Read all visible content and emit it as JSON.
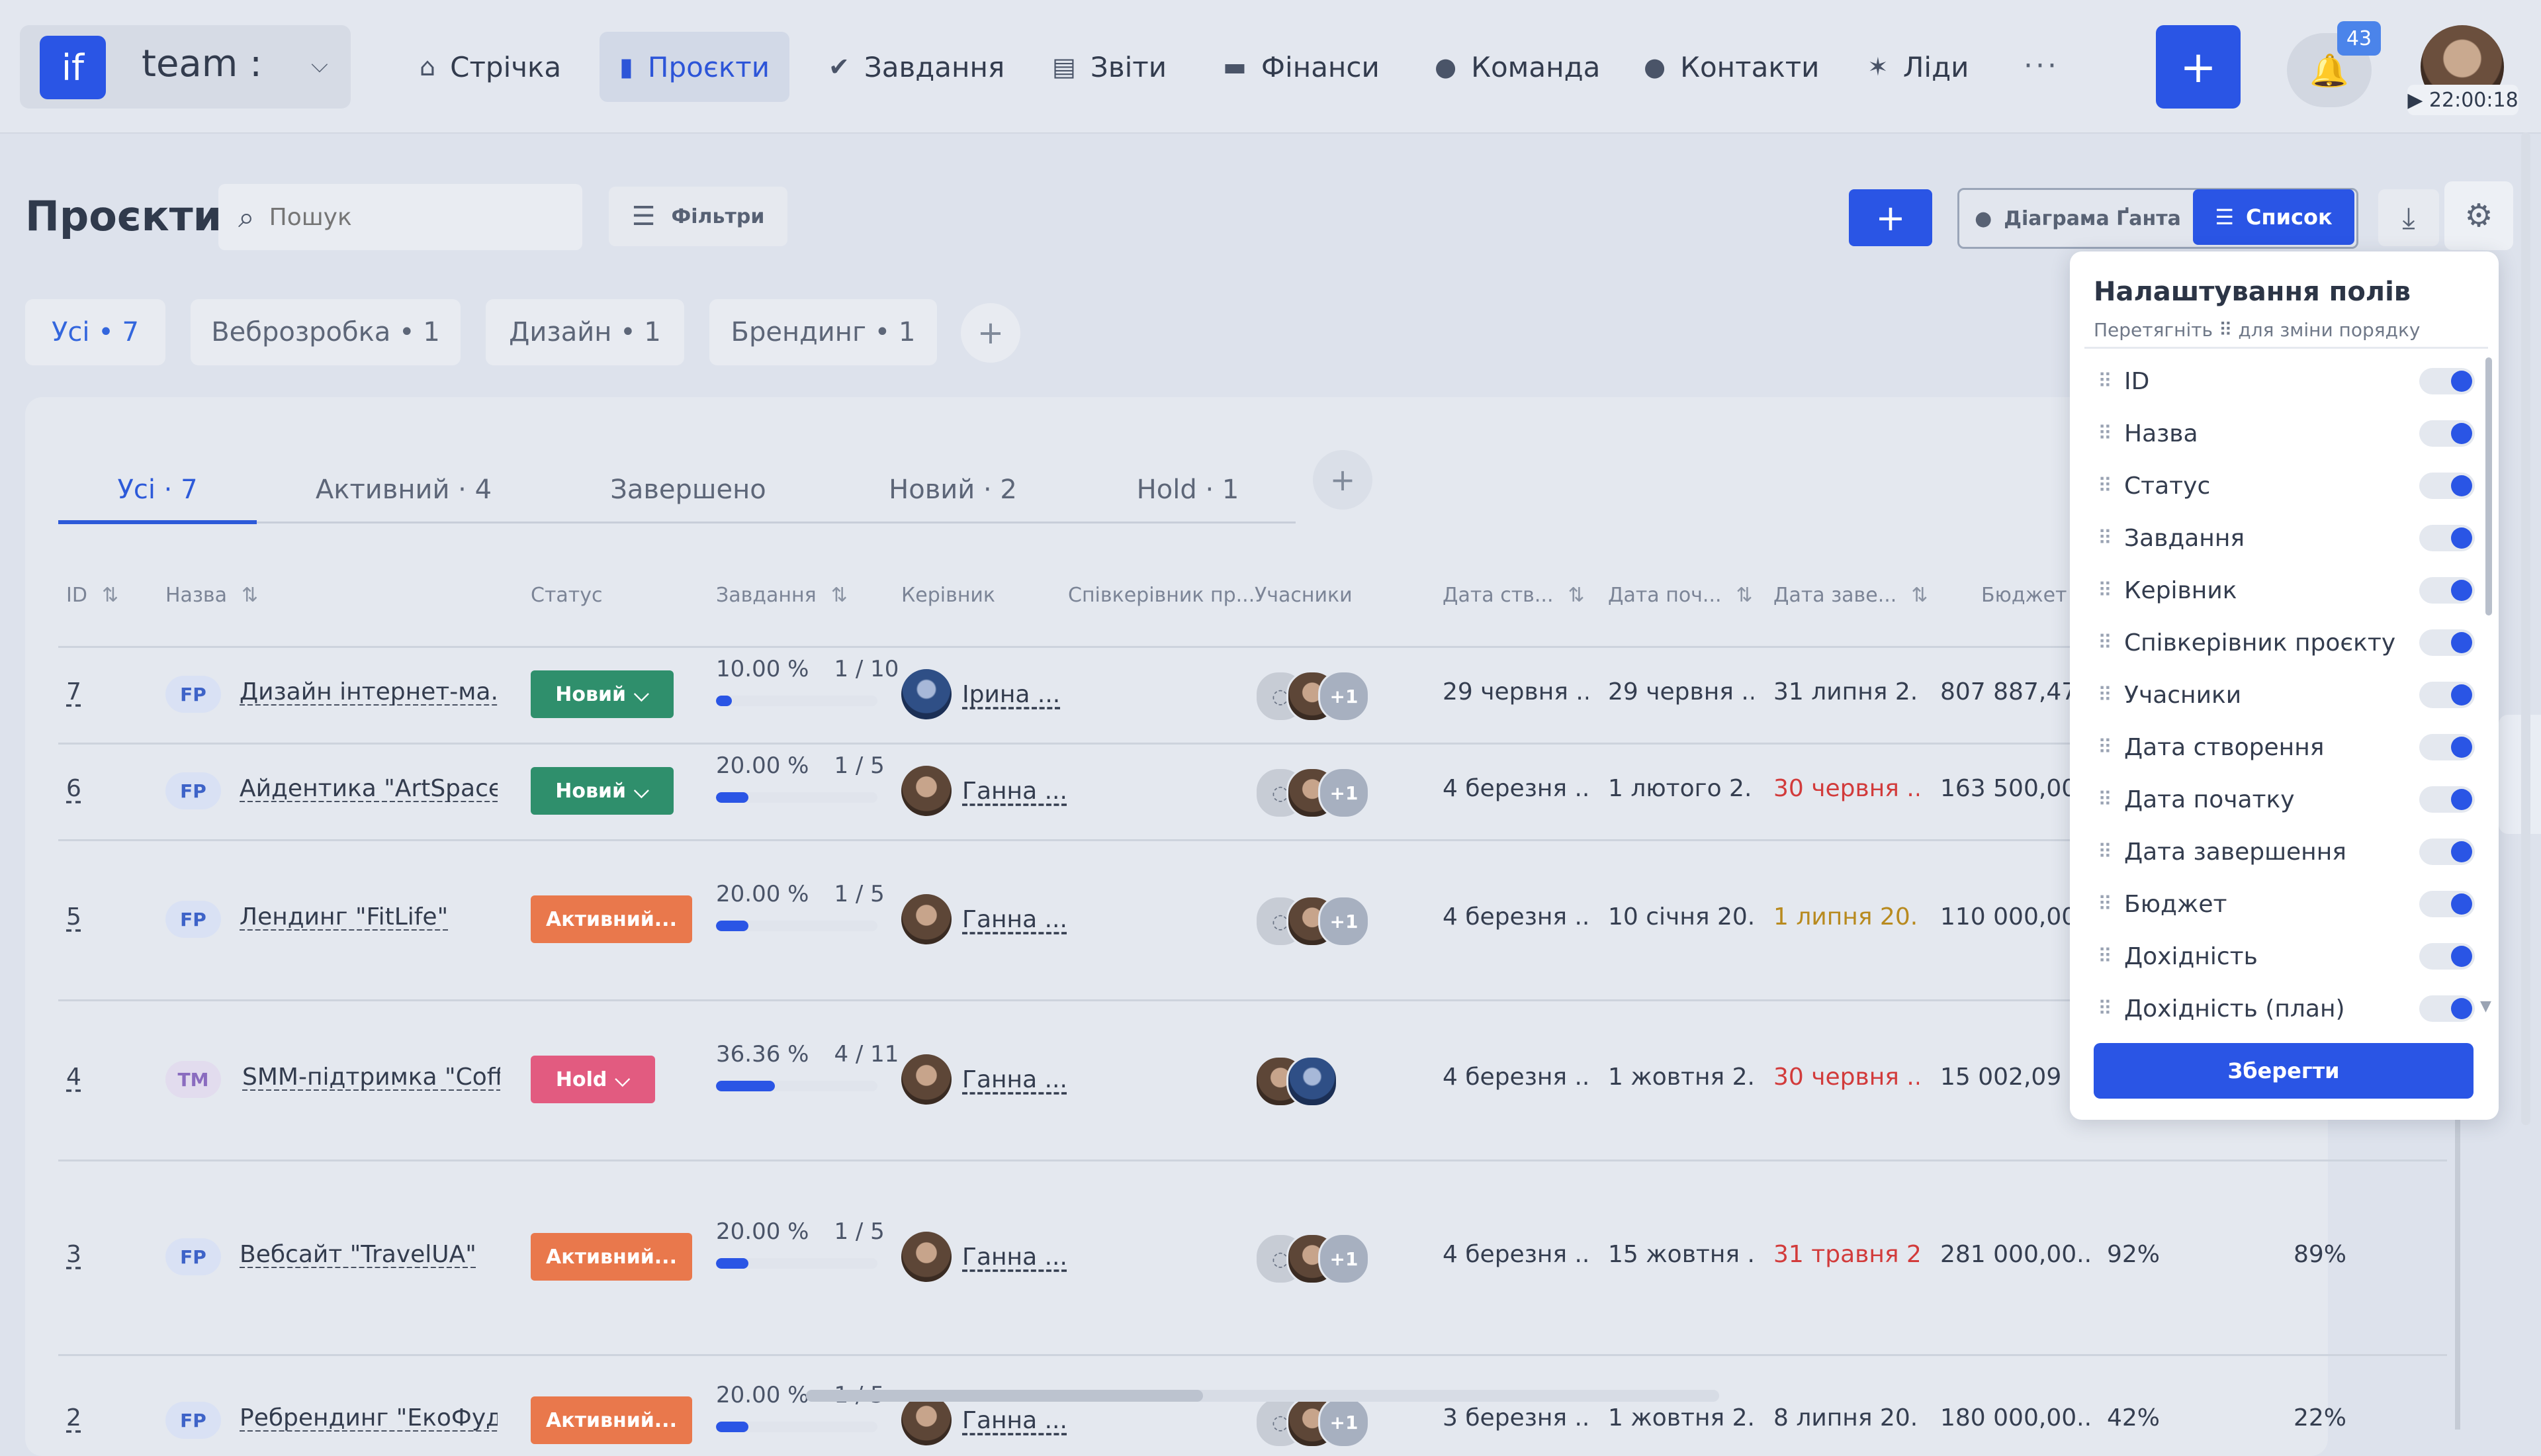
{
  "brand": {
    "logo_text": "if",
    "name": "team :",
    "chevron": "⌵"
  },
  "nav": [
    {
      "label": "Стрічка",
      "icon": "home-icon",
      "glyph": "⌂"
    },
    {
      "label": "Проєкти",
      "icon": "file-icon",
      "glyph": "▮"
    },
    {
      "label": "Завдання",
      "icon": "check-circle-icon",
      "glyph": "✔"
    },
    {
      "label": "Звіти",
      "icon": "report-icon",
      "glyph": "▤"
    },
    {
      "label": "Фінанси",
      "icon": "wallet-icon",
      "glyph": "▬"
    },
    {
      "label": "Команда",
      "icon": "user-icon",
      "glyph": "●"
    },
    {
      "label": "Контакти",
      "icon": "contacts-icon",
      "glyph": "●"
    },
    {
      "label": "Ліди",
      "icon": "leads-icon",
      "glyph": "✶"
    }
  ],
  "nav_more": "···",
  "notifications": {
    "count": "43",
    "glyph": "🔔"
  },
  "timer": "▶ 22:00:18",
  "page": {
    "title": "Проєкти",
    "search_placeholder": "Пошук",
    "filters_label": "Фільтри",
    "add_glyph": "+",
    "gantt_label": "Діаграма Ґанта",
    "list_label": "Список",
    "download_glyph": "⤓",
    "settings_glyph": "⚙"
  },
  "category_chips": [
    "Усі • 7",
    "Веброзробка • 1",
    "Дизайн • 1",
    "Брендинг • 1"
  ],
  "status_tabs": [
    "Усі · 7",
    "Активний · 4",
    "Завершено",
    "Новий · 2",
    "Hold · 1"
  ],
  "columns": {
    "id": "ID",
    "name": "Назва",
    "status": "Статус",
    "tasks": "Завдання",
    "manager": "Керівник",
    "co_manager": "Співкерівник пр...",
    "members": "Учасники",
    "created": "Дата ств...",
    "start": "Дата поч...",
    "end": "Дата заве...",
    "budget": "Бюджет"
  },
  "sort_glyph": "⇅",
  "rows": [
    {
      "id": "7",
      "tag": "FP",
      "name": "Дизайн інтернет-ма...",
      "status": "Новий",
      "pct": "10.00 %",
      "progress": 0.1,
      "tasks": "1 / 10",
      "manager": "Ірина ...",
      "members_more": "+1",
      "created": "29 червня ...",
      "start": "29 червня ...",
      "end": "31 липня 2...",
      "budget": "807 887,47 ₴",
      "col12": "",
      "col13": ""
    },
    {
      "id": "6",
      "tag": "FP",
      "name": "Айдентика \"ArtSpace\"",
      "status": "Новий",
      "pct": "20.00 %",
      "progress": 0.2,
      "tasks": "1 / 5",
      "manager": "Ганна ...",
      "members_more": "+1",
      "created": "4 березня ...",
      "start": "1 лютого 2...",
      "end": "30 червня ...",
      "budget": "163 500,00",
      "col12": "",
      "col13": ""
    },
    {
      "id": "5",
      "tag": "FP",
      "name": "Лендинг \"FitLife\"",
      "status": "Активний...",
      "pct": "20.00 %",
      "progress": 0.2,
      "tasks": "1 / 5",
      "manager": "Ганна ...",
      "members_more": "+1",
      "created": "4 березня ...",
      "start": "10 січня 20...",
      "end": "1 липня 20...",
      "budget": "110 000,00",
      "col12": "",
      "col13": ""
    },
    {
      "id": "4",
      "tag": "TM",
      "name": "SMM-підтримка \"Coff...",
      "status": "Hold",
      "pct": "36.36 %",
      "progress": 0.3636,
      "tasks": "4 / 11",
      "manager": "Ганна ...",
      "members_more": "",
      "created": "4 березня ...",
      "start": "1 жовтня 2...",
      "end": "30 червня ...",
      "budget": "15 002,09 ₴",
      "col12": "",
      "col13": ""
    },
    {
      "id": "3",
      "tag": "FP",
      "name": "Вебсайт \"TravelUA\"",
      "status": "Активний...",
      "pct": "20.00 %",
      "progress": 0.2,
      "tasks": "1 / 5",
      "manager": "Ганна ...",
      "members_more": "+1",
      "created": "4 березня ...",
      "start": "15 жовтня ...",
      "end": "31 травня 2...",
      "budget": "281 000,00...",
      "col12": "92%",
      "col13": "89%"
    },
    {
      "id": "2",
      "tag": "FP",
      "name": "Ребрендинг \"ЕкоФуд\"",
      "status": "Активний...",
      "pct": "20.00 %",
      "progress": 0.2,
      "tasks": "1 / 5",
      "manager": "Ганна ...",
      "members_more": "+1",
      "created": "3 березня ...",
      "start": "1 жовтня 2...",
      "end": "8 липня 20...",
      "budget": "180 000,00...",
      "col12": "42%",
      "col13": "22%"
    }
  ],
  "panel": {
    "title": "Налаштування полів",
    "subtitle": "Перетягніть ⠿ для зміни порядку",
    "grip": "⠿",
    "fields": [
      "ID",
      "Назва",
      "Статус",
      "Завдання",
      "Керівник",
      "Співкерівник проєкту",
      "Учасники",
      "Дата створення",
      "Дата початку",
      "Дата завершення",
      "Бюджет",
      "Дохідність",
      "Дохідність (план)"
    ],
    "save_label": "Зберегти"
  },
  "colors": {
    "accent": "#2a55e5",
    "new": "#2f8f6c",
    "active": "#e9784c",
    "hold": "#e25b80",
    "overdue": "#d23b3b",
    "soon": "#b88a1f"
  }
}
